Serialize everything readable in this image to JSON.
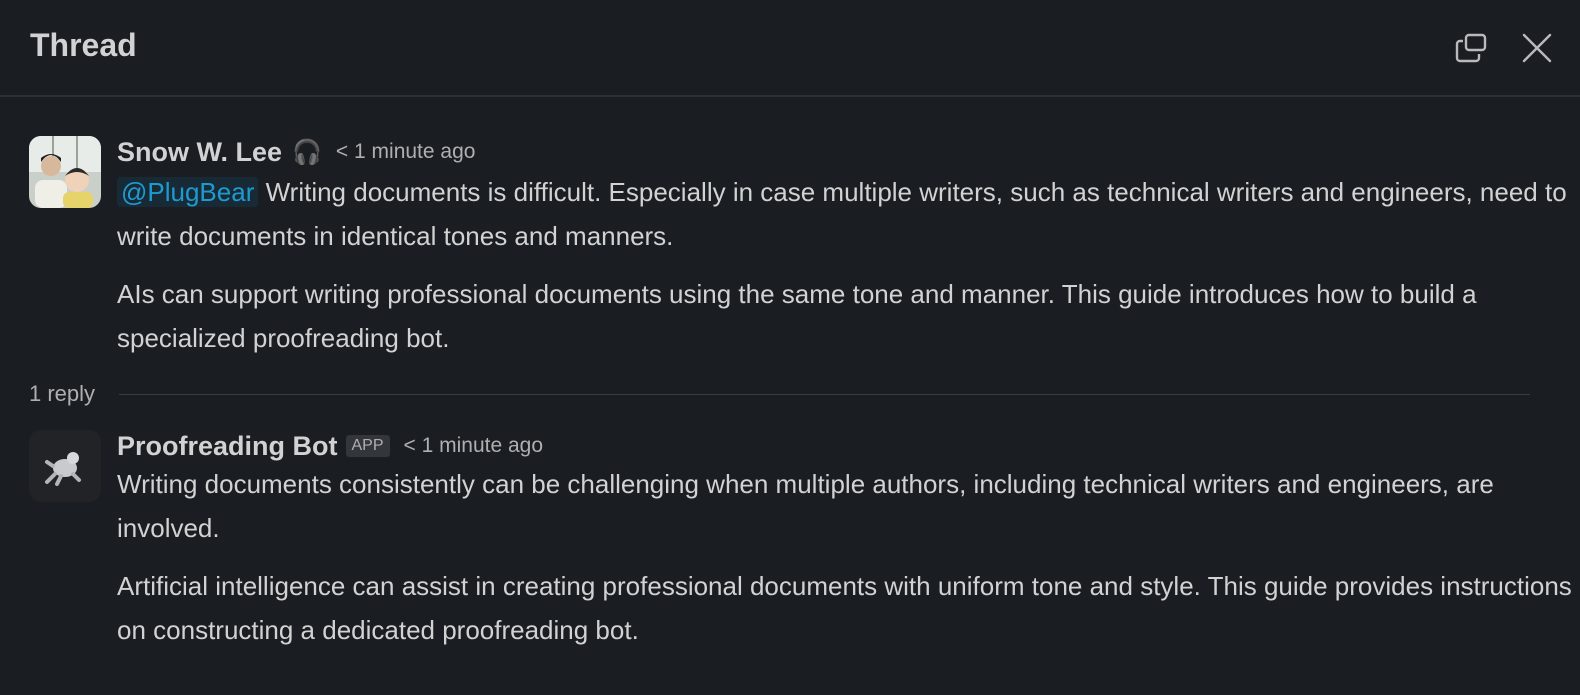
{
  "header": {
    "title": "Thread",
    "icons": [
      "open-in-window-icon",
      "close-icon"
    ]
  },
  "parent_message": {
    "author": "Snow W. Lee",
    "status_emoji": "🎧",
    "timestamp": "< 1 minute ago",
    "mention": "@PlugBear",
    "paragraph_1": "Writing documents is difficult. Especially in case multiple writers, such as technical writers and engineers, need to write documents in identical tones and manners.",
    "paragraph_2": "AIs can support writing professional documents using the same tone and manner. This guide introduces how to build a specialized proofreading bot."
  },
  "replies": {
    "count_label": "1 reply"
  },
  "reply_message": {
    "author": "Proofreading Bot",
    "badge": "APP",
    "timestamp": "< 1 minute ago",
    "paragraph_1": "Writing documents consistently can be challenging when multiple authors, including technical writers and engineers, are involved.",
    "paragraph_2": "Artificial intelligence can assist in creating professional documents with uniform tone and style. This guide provides instructions on constructing a dedicated proofreading bot."
  }
}
